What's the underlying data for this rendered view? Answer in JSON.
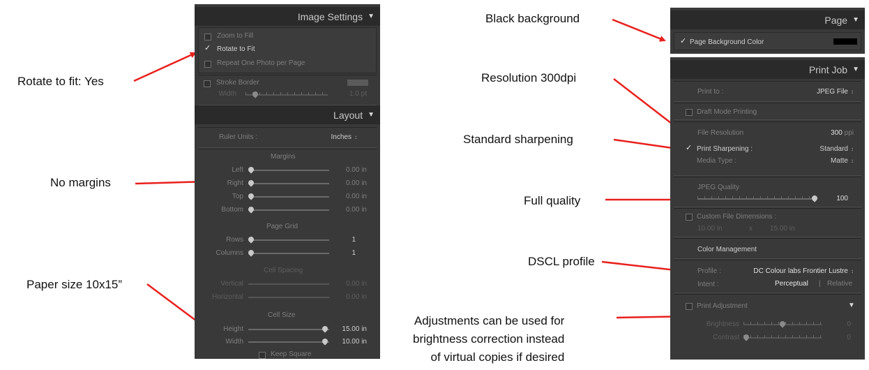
{
  "annotations": {
    "rotate": "Rotate to fit: Yes",
    "margins": "No margins",
    "paper": "Paper size 10x15”",
    "black_bg": "Black background",
    "resolution": "Resolution 300dpi",
    "sharpening": "Standard sharpening",
    "quality": "Full quality",
    "profile": "DSCL profile",
    "adjust_1": "Adjustments can be used for",
    "adjust_2": "brightness correction instead",
    "adjust_3": "of virtual copies if desired"
  },
  "colors": {
    "arrow": "#e8201c",
    "panel": "#393939",
    "header": "#2a2a2a"
  },
  "image_settings": {
    "title": "Image Settings",
    "zoom_to_fill": "Zoom to Fill",
    "rotate_to_fit": "Rotate to Fit",
    "repeat_one": "Repeat One Photo per Page",
    "stroke_border": "Stroke Border",
    "width_label": "Width",
    "width_value": "1.0 pt",
    "width_level": 0.1
  },
  "layout": {
    "title": "Layout",
    "ruler_units_label": "Ruler Units :",
    "ruler_units_value": "Inches",
    "margins_heading": "Margins",
    "left_label": "Left",
    "left_value": "0.00 in",
    "right_label": "Right",
    "right_value": "0.00 in",
    "top_label": "Top",
    "top_value": "0.00 in",
    "bottom_label": "Bottom",
    "bottom_value": "0.00 in",
    "page_grid_heading": "Page Grid",
    "rows_label": "Rows",
    "rows_value": "1",
    "columns_label": "Columns",
    "columns_value": "1",
    "cell_spacing_heading": "Cell Spacing",
    "vertical_label": "Vertical",
    "vertical_value": "0.00 in",
    "horizontal_label": "Horizontal",
    "horizontal_value": "0.00 in",
    "cell_size_heading": "Cell Size",
    "height_label": "Height",
    "height_value": "15.00 in",
    "width_label": "Width",
    "width_value": "10.00 in",
    "keep_square": "Keep Square"
  },
  "page": {
    "title": "Page",
    "bg_color_label": "Page Background Color",
    "bg_color": "#000000"
  },
  "print_job": {
    "title": "Print Job",
    "print_to_label": "Print to :",
    "print_to_value": "JPEG File",
    "draft_mode": "Draft Mode Printing",
    "file_resolution_label": "File Resolution",
    "file_resolution_value": "300",
    "file_resolution_unit": "ppi",
    "print_sharpening_label": "Print Sharpening :",
    "print_sharpening_value": "Standard",
    "media_type_label": "Media Type :",
    "media_type_value": "Matte",
    "jpeg_quality_label": "JPEG Quality",
    "jpeg_quality_value": "100",
    "custom_dims_label": "Custom File Dimensions :",
    "dim_w": "10.00",
    "dim_unit": "in",
    "dim_x": "x",
    "dim_h": "15.00",
    "color_mgmt": "Color Management",
    "profile_label": "Profile :",
    "profile_value": "DC Colour labs Frontier Lustre",
    "intent_label": "Intent :",
    "intent_perceptual": "Perceptual",
    "intent_sep": "|",
    "intent_relative": "Relative",
    "print_adjustment": "Print Adjustment",
    "brightness_label": "Brightness",
    "brightness_value": "0",
    "contrast_label": "Contrast",
    "contrast_value": "0"
  }
}
